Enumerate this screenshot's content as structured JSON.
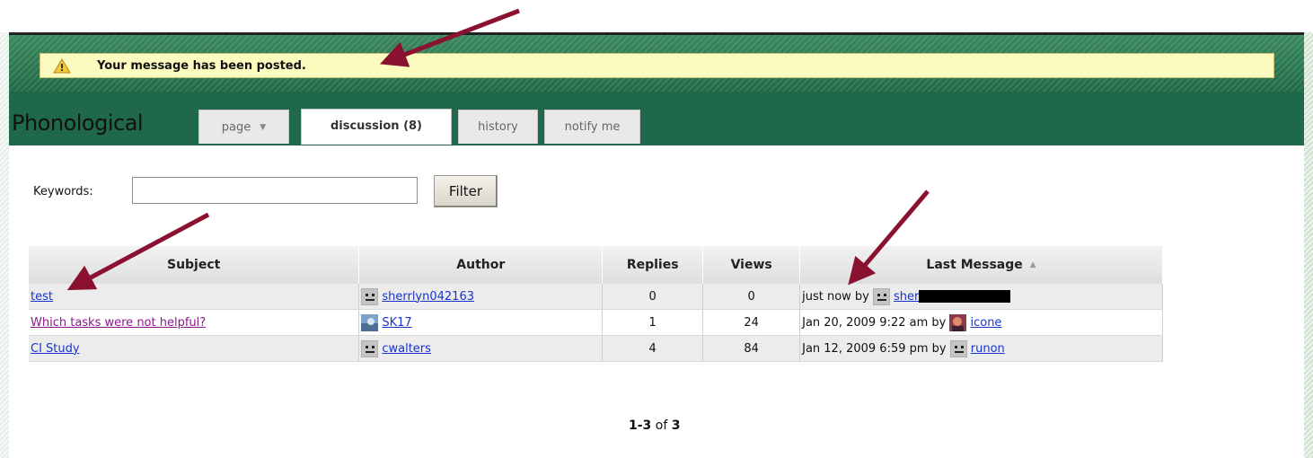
{
  "notice": {
    "message": "Your message has been posted."
  },
  "page": {
    "title": "Phonological"
  },
  "tabs": [
    {
      "label": "page",
      "has_dropdown": true
    },
    {
      "label": "discussion (8)",
      "active": true
    },
    {
      "label": "history"
    },
    {
      "label": "notify me"
    }
  ],
  "filter": {
    "keywords_label": "Keywords:",
    "keywords_value": "",
    "button_label": "Filter"
  },
  "table": {
    "columns": [
      "Subject",
      "Author",
      "Replies",
      "Views",
      "Last Message"
    ],
    "sort_indicator": "▲",
    "rows": [
      {
        "subject": "test",
        "author": "sherrlyn042163",
        "author_icon": "default-face-icon",
        "replies": "0",
        "views": "0",
        "last_prefix": "just now by",
        "last_user": "sher",
        "last_user_icon": "default-face-icon",
        "last_redacted": true
      },
      {
        "subject": "Which tasks were not helpful?",
        "subject_visited": true,
        "author": "SK17",
        "author_icon": "photo-avatar-icon",
        "replies": "1",
        "views": "24",
        "last_prefix": "Jan 20, 2009 9:22 am by",
        "last_user": "icone",
        "last_user_icon": "photo-avatar-icon"
      },
      {
        "subject": "CI Study",
        "author": "cwalters",
        "author_icon": "default-face-icon",
        "replies": "4",
        "views": "84",
        "last_prefix": "Jan 12, 2009 6:59 pm by",
        "last_user": "runon",
        "last_user_icon": "default-face-icon"
      }
    ]
  },
  "pager": {
    "range": "1-3",
    "of_label": "of",
    "total": "3"
  },
  "colors": {
    "header_green": "#20684a",
    "notice_bg": "#fbfbc0",
    "arrow": "#8a1230",
    "link": "#1a33cc",
    "visited_link": "#8a1a8a"
  }
}
